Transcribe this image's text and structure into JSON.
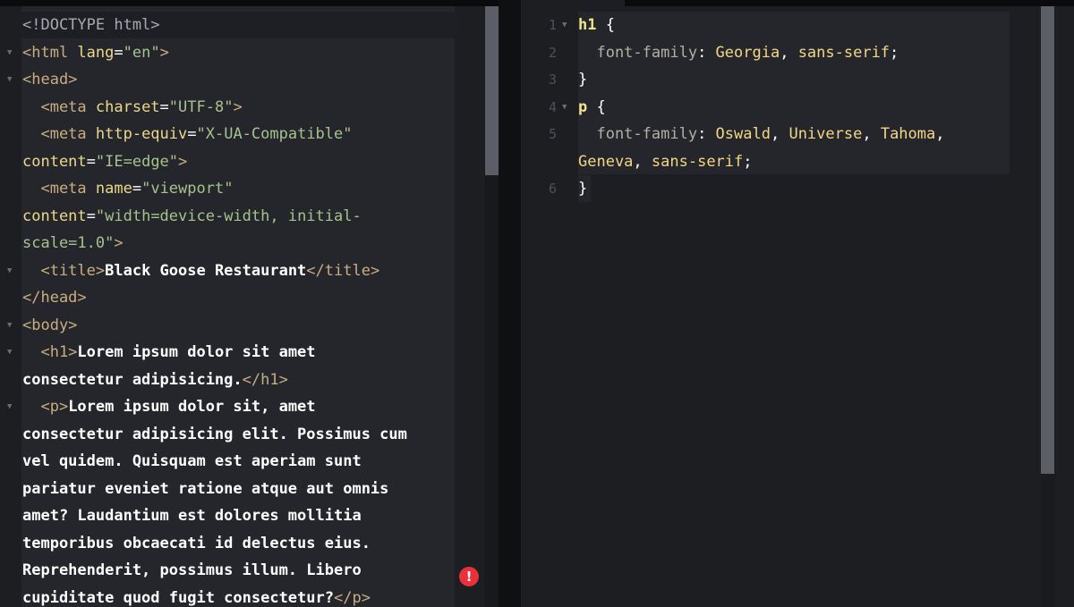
{
  "html_editor": {
    "lines": [
      "<!DOCTYPE html>",
      "<html lang=\"en\">",
      "<head>",
      "<meta charset=\"UTF-8\">",
      "<meta http-equiv=\"X-UA-Compatible\" content=\"IE=edge\">",
      "<meta name=\"viewport\" content=\"width=device-width, initial-scale=1.0\">",
      "<title>Black Goose Restaurant</title>",
      "</head>",
      "<body>",
      "<h1>Lorem ipsum dolor sit amet consectetur adipisicing.</h1>",
      "<p>Lorem ipsum dolor sit, amet consectetur adipisicing elit. Possimus cum vel quidem. Quisquam est aperiam sunt pariatur eveniet ratione atque aut omnis amet? Laudantium est dolores mollitia temporibus obcaecati id delectus eius. Reprehenderit, possimus illum. Libero cupiditate quod fugit consectetur?</p>"
    ],
    "error_icon": "error-icon",
    "error_color": "#e8313a"
  },
  "css_editor": {
    "line_numbers": [
      "1",
      "2",
      "3",
      "4",
      "5",
      "6"
    ],
    "lines": [
      "h1 {",
      "font-family: Georgia, sans-serif;",
      "}",
      "p {",
      "font-family: Oswald, Universe, Tahoma, Geneva, sans-serif;",
      "}"
    ],
    "fold_icon": "fold-arrow-icon"
  },
  "colors": {
    "background": "#1d1e22",
    "code_background": "#25262b",
    "tag": "#c9ad82",
    "attribute": "#ecd88a",
    "string": "#a6c28e",
    "text": "#ffffff",
    "selector": "#f1e58a",
    "property": "#b2b0a6",
    "value": "#f2d785"
  }
}
